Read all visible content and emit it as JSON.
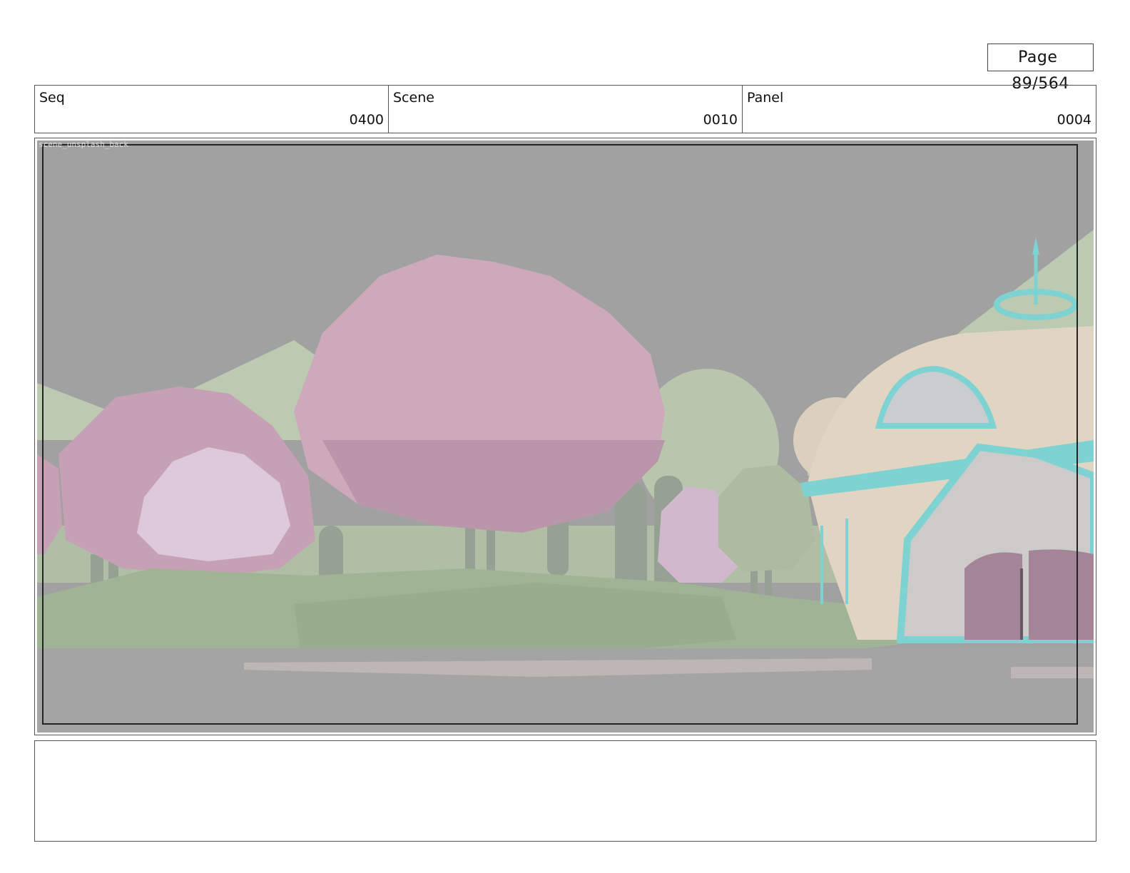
{
  "page": {
    "label": "Page",
    "current": "89/564"
  },
  "header": {
    "seq": {
      "label": "Seq",
      "value": "0400"
    },
    "scene": {
      "label": "Scene",
      "value": "0010"
    },
    "panel": {
      "label": "Panel",
      "value": "0004"
    }
  },
  "panel_image": {
    "overlay_text": "scene_unsplash_back",
    "palette": {
      "sky": "#9a9a9a",
      "hill": "#b7c6ab",
      "tree_pink": "#c49bb0",
      "tree_lilac": "#dcc4d8",
      "tree_green": "#a9b99d",
      "trunk": "#8e998a",
      "grass": "#97ad8c",
      "ground": "#9d9d9d",
      "path": "#b9b0ae",
      "building": "#ddd2bd",
      "trim": "#73cfcf",
      "door": "#9c7b8f"
    }
  },
  "notes": {
    "text": ""
  }
}
